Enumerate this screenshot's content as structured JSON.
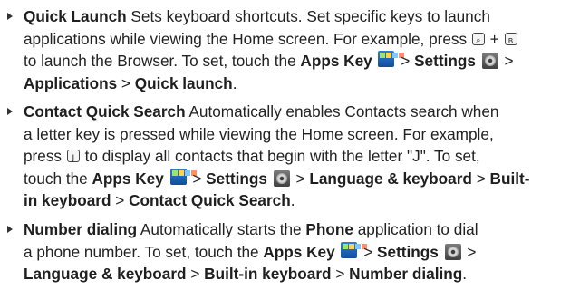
{
  "items": [
    {
      "l1": {
        "title": "Quick Launch",
        "text": " Sets keyboard shortcuts. Set specific keys to launch"
      },
      "l2": {
        "text": "applications while viewing the Home screen. For example, press ",
        "plus": "+"
      },
      "l3": {
        "text": "to launch the Browser. To set, touch the ",
        "apps": "Apps Key",
        "gt1": ">",
        "settings": "Settings",
        "gt2": ">"
      },
      "l4": {
        "applications": "Applications",
        "gt": ">",
        "quick": "Quick launch",
        "end": "."
      }
    },
    {
      "l1": {
        "title": "Contact Quick Search",
        "text": " Automatically enables Contacts search when"
      },
      "l2": {
        "text": "a letter key is pressed while viewing the Home screen.  For example,"
      },
      "l3": {
        "pre": "press",
        "text": " to display all contacts that begin with the letter \"J\".  To set,"
      },
      "l4": {
        "pre": "touch the ",
        "apps": "Apps Key",
        "gt1": ">",
        "settings": "Settings",
        "gt2": ">",
        "lang": "Language & keyboard",
        "gt3": ">",
        "built": "Built-"
      },
      "l5": {
        "built": "in keyboard",
        "gt": ">",
        "cqs": "Contact Quick Search",
        "end": "."
      }
    },
    {
      "l1": {
        "title": "Number dialing",
        "text": " Automatically starts the ",
        "phone": "Phone",
        "text2": " application to dial"
      },
      "l2": {
        "text": "a phone number. To set, touch the ",
        "apps": "Apps Key",
        "gt1": ">",
        "settings": "Settings",
        "gt2": ">"
      },
      "l3": {
        "lang": "Language & keyboard",
        "gt1": ">",
        "built": "Built-in keyboard",
        "gt2": ">",
        "nd": "Number dialing",
        "end": "."
      }
    }
  ],
  "keys": {
    "search_glyph": "⌕",
    "browser_glyph": "B",
    "j_glyph": "J"
  }
}
